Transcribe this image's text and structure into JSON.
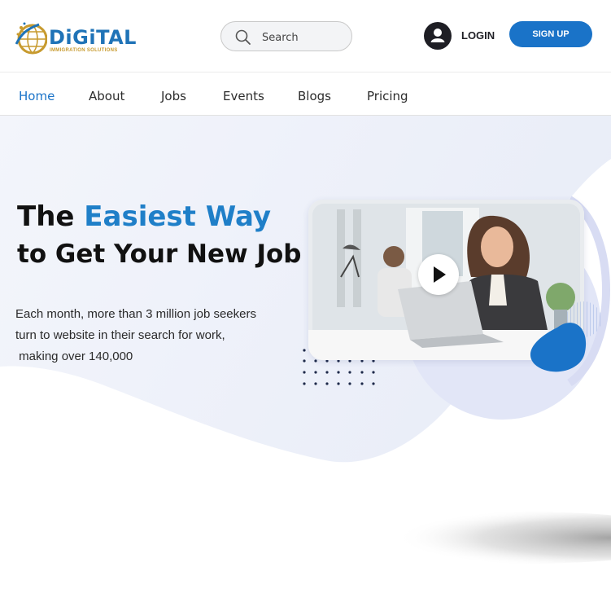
{
  "header": {
    "logo": {
      "name": "DiGiTAL",
      "tagline": "IMMIGRATION SOLUTIONS"
    },
    "search": {
      "placeholder": "Search",
      "icon": "search-icon"
    },
    "user_icon": "user-icon",
    "login_label": "LOGIN",
    "signup_label": "SIGN UP"
  },
  "nav": {
    "items": [
      {
        "label": "Home",
        "active": true
      },
      {
        "label": "About"
      },
      {
        "label": "Jobs"
      },
      {
        "label": "Events"
      },
      {
        "label": "Blogs"
      },
      {
        "label": "Pricing"
      }
    ]
  },
  "hero": {
    "title_prefix": "The ",
    "title_highlight": "Easiest Way",
    "title_line2": "to Get Your New Job",
    "description_line1": "Each month, more than 3 million job seekers",
    "description_line2": "turn to website in their search for work,",
    "description_line3": " making over 140,000",
    "play_icon": "play-icon"
  },
  "colors": {
    "brand_blue": "#1a73c8",
    "highlight_blue": "#1f7fc8",
    "logo_gold": "#c79a2e",
    "hero_tint": "#eef1fa",
    "dark": "#1e1e24"
  }
}
